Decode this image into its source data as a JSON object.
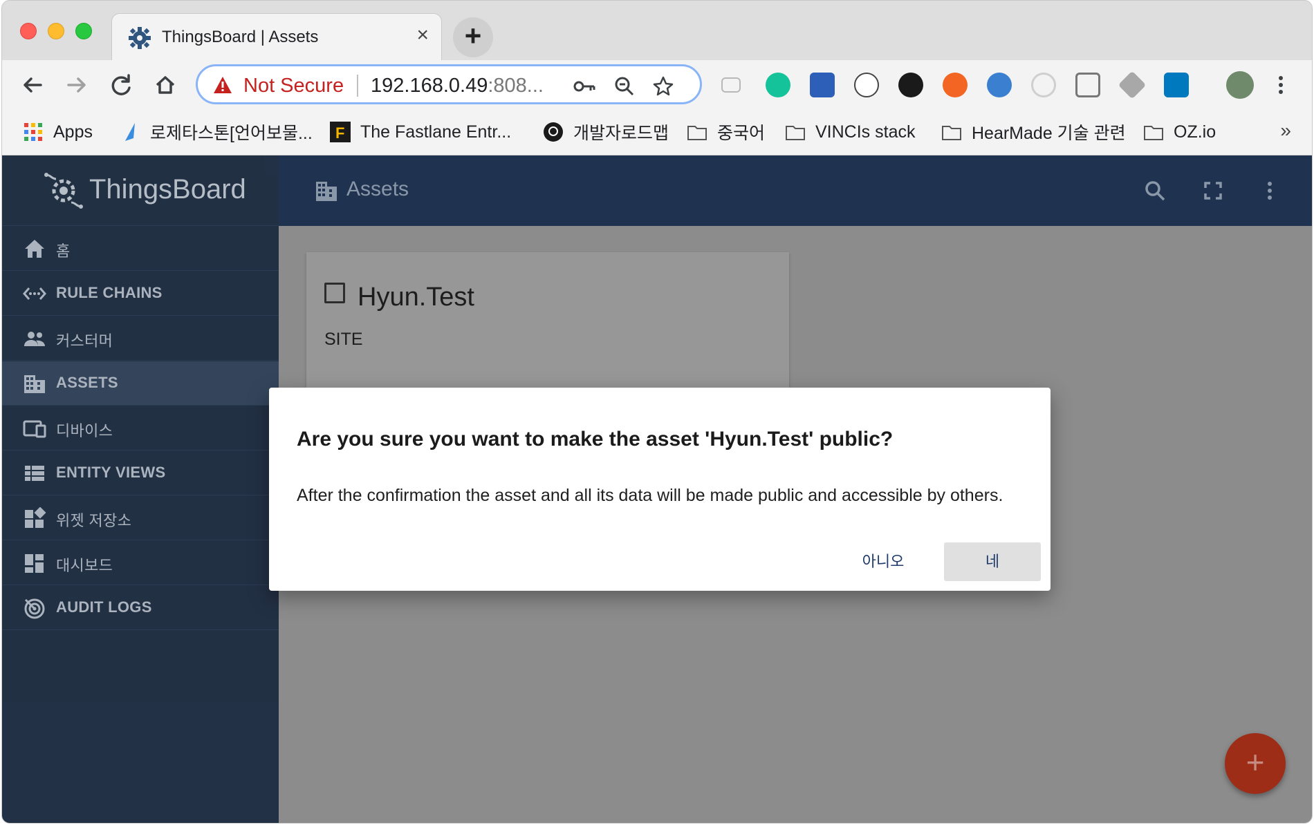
{
  "browser": {
    "tab": {
      "title": "ThingsBoard | Assets",
      "close_glyph": "×",
      "icon": "thingsboard-gear-icon"
    },
    "new_tab_glyph": "+",
    "nav": {
      "back": "back-arrow-icon",
      "forward": "forward-arrow-icon",
      "reload": "reload-icon",
      "home": "home-icon"
    },
    "omnibox": {
      "security_label": "Not Secure",
      "url_host": "192.168.0.49",
      "url_rest": ":808..."
    },
    "bookmarks": [
      {
        "label": "Apps",
        "icon": "apps-grid-icon"
      },
      {
        "label": "로제타스톤[언어보물...",
        "icon": "rosetta-icon"
      },
      {
        "label": "The Fastlane Entr...",
        "icon": "fastlane-icon"
      },
      {
        "label": "개발자로드맵",
        "icon": "github-icon"
      },
      {
        "label": "중국어",
        "icon": "folder-icon"
      },
      {
        "label": "VINCIs stack",
        "icon": "folder-icon"
      },
      {
        "label": "HearMade 기술 관련",
        "icon": "folder-icon"
      },
      {
        "label": "OZ.io",
        "icon": "folder-icon"
      }
    ],
    "bookmarks_more": "»"
  },
  "app": {
    "logo_text": "ThingsBoard",
    "sidebar": [
      {
        "label": "홈",
        "icon": "home-icon"
      },
      {
        "label": "RULE CHAINS",
        "icon": "rule-chains-icon"
      },
      {
        "label": "커스터머",
        "icon": "customers-icon"
      },
      {
        "label": "ASSETS",
        "icon": "assets-building-icon",
        "active": true
      },
      {
        "label": "디바이스",
        "icon": "devices-icon"
      },
      {
        "label": "ENTITY VIEWS",
        "icon": "entity-views-icon"
      },
      {
        "label": "위젯 저장소",
        "icon": "widgets-icon"
      },
      {
        "label": "대시보드",
        "icon": "dashboard-icon"
      },
      {
        "label": "AUDIT LOGS",
        "icon": "audit-logs-icon"
      }
    ],
    "topbar": {
      "title": "Assets"
    },
    "asset_card": {
      "name": "Hyun.Test",
      "type": "SITE"
    },
    "fab_label": "+"
  },
  "dialog": {
    "title": "Are you sure you want to make the asset 'Hyun.Test' public?",
    "body": "After the confirmation the asset and all its data will be made public and accessible by others.",
    "cancel_label": "아니오",
    "confirm_label": "네"
  },
  "colors": {
    "sidebar_bg": "#1a2a3f",
    "topbar_bg": "#1f3350",
    "fab": "#9e2d18",
    "not_secure_red": "#c5221f",
    "dialog_button_text": "#1f3b6c"
  }
}
